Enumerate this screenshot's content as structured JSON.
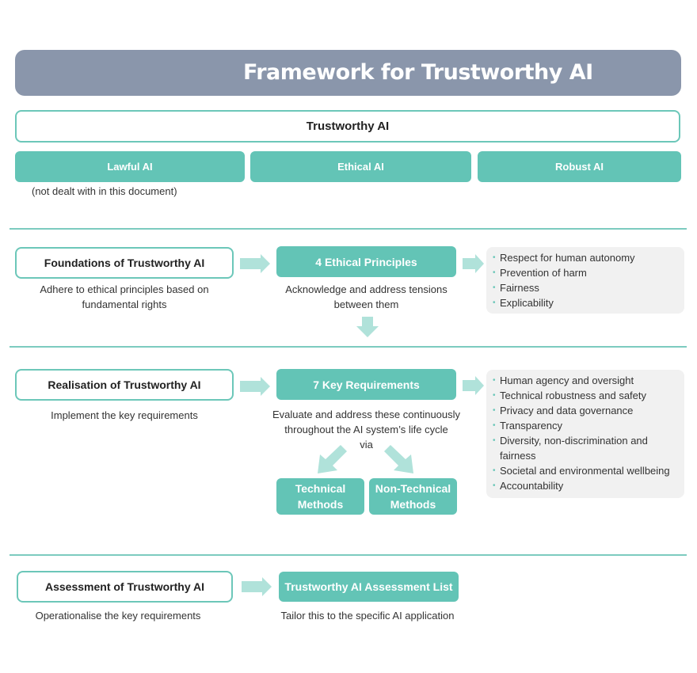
{
  "title": "Framework for Trustworthy AI",
  "top": {
    "trustworthy_label": "Trustworthy AI",
    "pillars": [
      {
        "label": "Lawful AI"
      },
      {
        "label": "Ethical AI"
      },
      {
        "label": "Robust AI"
      }
    ],
    "lawful_note": "(not dealt with in this document)"
  },
  "foundations": {
    "box_label": "Foundations of Trustworthy AI",
    "box_caption": "Adhere to ethical principles based on fundamental rights",
    "principles_label": "4 Ethical Principles",
    "principles_caption": "Acknowledge and address tensions between them",
    "principles": [
      "Respect for human autonomy",
      "Prevention of harm",
      "Fairness",
      "Explicability"
    ]
  },
  "realisation": {
    "box_label": "Realisation of Trustworthy AI",
    "box_caption": "Implement the key requirements",
    "requirements_label": "7 Key Requirements",
    "requirements_caption_line1": "Evaluate and address these continuously",
    "requirements_caption_line2": "throughout the AI system’s life cycle",
    "requirements_caption_line3": "via",
    "methods": [
      {
        "line1": "Technical",
        "line2": "Methods"
      },
      {
        "line1": "Non-Technical",
        "line2": "Methods"
      }
    ],
    "requirements": [
      "Human agency and oversight",
      "Technical robustness and safety",
      "Privacy and data governance",
      "Transparency",
      "Diversity, non-discrimination and fairness",
      "Societal and environmental wellbeing",
      "Accountability"
    ]
  },
  "assessment": {
    "box_label": "Assessment of Trustworthy AI",
    "box_caption": "Operationalise the key requirements",
    "list_label": "Trustworthy AI Assessment List",
    "list_caption": "Tailor this to the specific AI application"
  },
  "colors": {
    "title_bar": "#8a96ab",
    "teal": "#63c4b6",
    "arrow": "#b0e2da",
    "outline": "#6cc7b9",
    "list_bg": "#f1f1f1"
  }
}
